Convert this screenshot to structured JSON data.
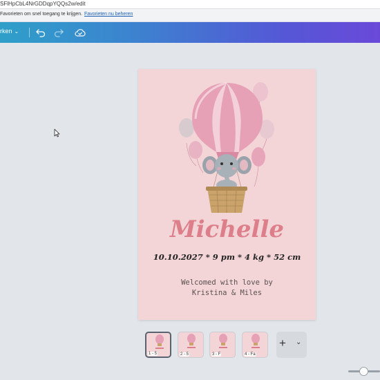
{
  "browser": {
    "url": "SFlHpCbL4NrGDDqpYQQs2w/edit",
    "favorites_message": "Favorieten om snel toegang te krijgen.",
    "favorites_link": "Favorieten nu beheren"
  },
  "toolbar": {
    "file_menu_label": "rken",
    "icons": [
      "undo-icon",
      "redo-icon",
      "cloud-save-icon"
    ]
  },
  "design": {
    "name": "Michelle",
    "details": "10.10.2027 * 9 pm * 4 kg * 52 cm",
    "welcome_line1": "Welcomed with love by",
    "welcome_line2": "Kristina & Miles",
    "colors": {
      "page": "#f3d5d7",
      "name": "#dd7f8b",
      "balloon": "#e9a3b8"
    }
  },
  "pages": [
    {
      "label": "1 - 5",
      "active": true
    },
    {
      "label": "2 - 5",
      "active": false
    },
    {
      "label": "3 - F",
      "active": false
    },
    {
      "label": "4 - Fa",
      "active": false
    }
  ],
  "add_page_icons": [
    "plus-icon",
    "chevron-down-icon"
  ]
}
